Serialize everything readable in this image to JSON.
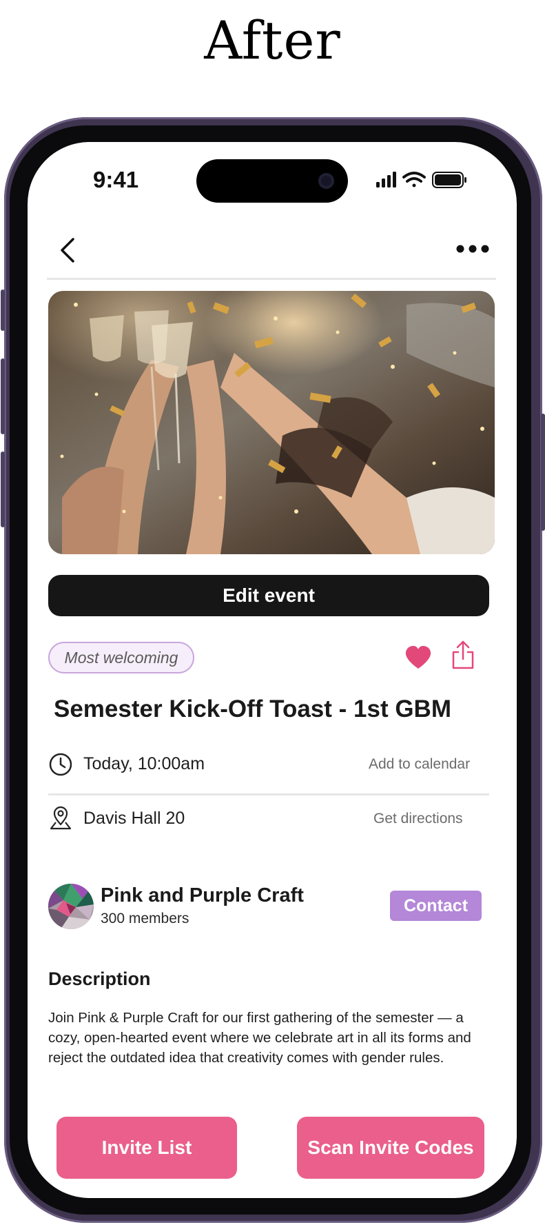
{
  "caption": "After",
  "status_bar": {
    "time": "9:41"
  },
  "nav": {
    "back_icon": "chevron-left-icon",
    "more_icon": "more-horizontal-icon"
  },
  "event": {
    "hero_image": "celebration toast photo",
    "edit_label": "Edit event",
    "tag": "Most welcoming",
    "title": "Semester Kick-Off Toast - 1st GBM",
    "time": "Today, 10:00am",
    "add_calendar": "Add to calendar",
    "location": "Davis Hall 20",
    "directions": "Get directions"
  },
  "organizer": {
    "name": "Pink and Purple Craft",
    "members": "300 members",
    "contact_label": "Contact"
  },
  "description": {
    "heading": "Description",
    "body": "Join Pink & Purple Craft for our first gathering of the semester — a cozy, open-hearted event where we celebrate art in all its forms and reject the outdated idea that creativity comes with gender rules."
  },
  "actions": {
    "invite_list": "Invite List",
    "scan_codes": "Scan Invite Codes"
  },
  "colors": {
    "accent_pink": "#EA5F8C",
    "heart_pink": "#E2487A",
    "contact_purple": "#B487D8",
    "tag_border": "#C9A6DE",
    "phone_frame": "#3F3550"
  }
}
